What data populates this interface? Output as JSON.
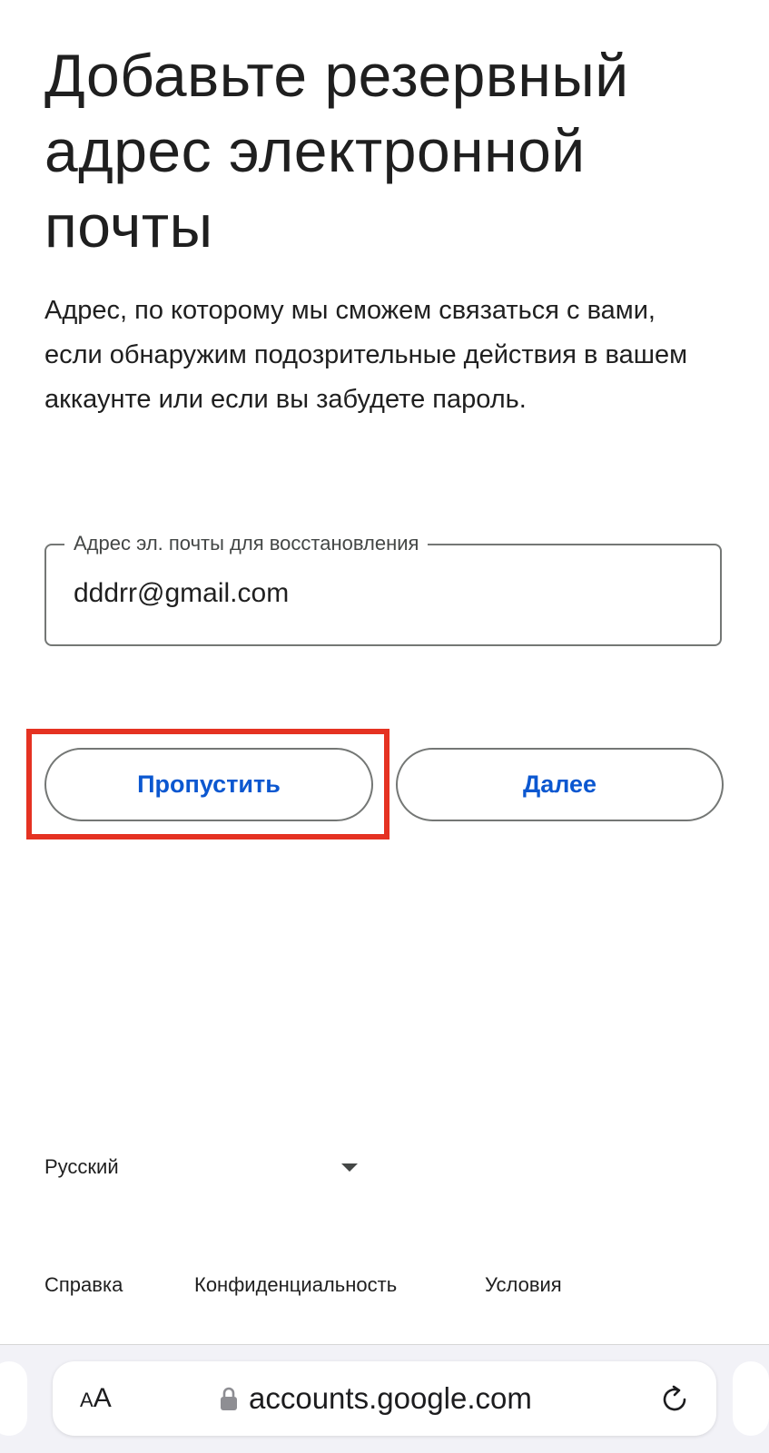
{
  "header": {
    "title": "Добавьте резервный адрес электронной почты"
  },
  "main": {
    "description": "Адрес, по которому мы сможем связаться с вами, если обнаружим подозрительные действия в вашем аккаунте или если вы забудете пароль.",
    "recovery_email_field": {
      "label": "Адрес эл. почты для восстановления",
      "value": "dddrr@gmail.com"
    },
    "buttons": {
      "skip_label": "Пропустить",
      "next_label": "Далее"
    }
  },
  "footer": {
    "language": "Русский",
    "links": {
      "help": "Справка",
      "privacy": "Конфиденциальность",
      "terms": "Условия"
    }
  },
  "browser": {
    "text_size_small": "A",
    "text_size_large": "A",
    "url": "accounts.google.com"
  },
  "colors": {
    "button_text": "#0b57d0",
    "highlight_box": "#e53222",
    "outline": "#747775"
  },
  "icons": {
    "lock": "lock-icon",
    "reload": "reload-icon",
    "dropdown": "caret-down-icon"
  }
}
